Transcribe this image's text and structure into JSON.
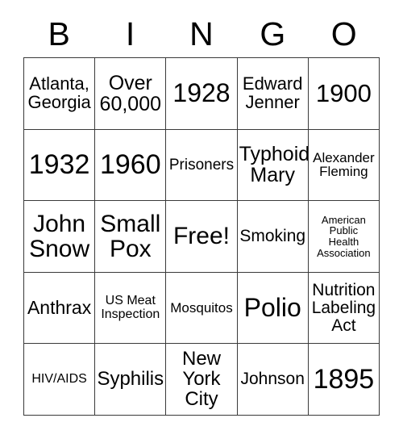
{
  "card": {
    "title": "BINGO",
    "free_space_label": "Free!",
    "text_color": "#000000",
    "border_color": "#3a3a3a",
    "background_color": "#ffffff"
  },
  "header": {
    "letters": [
      {
        "label": "B"
      },
      {
        "label": "I"
      },
      {
        "label": "N"
      },
      {
        "label": "G"
      },
      {
        "label": "O"
      }
    ]
  },
  "grid": {
    "columns": 5,
    "rows": 5,
    "cells": [
      {
        "text": "Atlanta,\nGeorgia",
        "size": "fs-22",
        "column": "B",
        "row": 1
      },
      {
        "text": "Over\n60,000",
        "size": "fs-25",
        "column": "I",
        "row": 1
      },
      {
        "text": "1928",
        "size": "fs-32",
        "column": "N",
        "row": 1
      },
      {
        "text": "Edward\nJenner",
        "size": "fs-22",
        "column": "G",
        "row": 1
      },
      {
        "text": "1900",
        "size": "fs-31",
        "column": "O",
        "row": 1
      },
      {
        "text": "1932",
        "size": "fs-34",
        "column": "B",
        "row": 2
      },
      {
        "text": "1960",
        "size": "fs-34",
        "column": "I",
        "row": 2
      },
      {
        "text": "Prisoners",
        "size": "fs-19",
        "column": "N",
        "row": 2
      },
      {
        "text": "Typhoid\nMary",
        "size": "fs-25",
        "column": "G",
        "row": 2
      },
      {
        "text": "Alexander\nFleming",
        "size": "fs-17",
        "column": "O",
        "row": 2
      },
      {
        "text": "John\nSnow",
        "size": "fs-30",
        "column": "B",
        "row": 3
      },
      {
        "text": "Small\nPox",
        "size": "fs-30",
        "column": "I",
        "row": 3
      },
      {
        "text": "Free!",
        "size": "fs-30",
        "column": "N",
        "row": 3
      },
      {
        "text": "Smoking",
        "size": "fs-21",
        "column": "G",
        "row": 3
      },
      {
        "text": "American\nPublic\nHealth\nAssociation",
        "size": "fs-13",
        "column": "O",
        "row": 3
      },
      {
        "text": "Anthrax",
        "size": "fs-23",
        "column": "B",
        "row": 4
      },
      {
        "text": "US Meat\nInspection",
        "size": "fs-16",
        "column": "I",
        "row": 4
      },
      {
        "text": "Mosquitos",
        "size": "fs-17",
        "column": "N",
        "row": 4
      },
      {
        "text": "Polio",
        "size": "fs-32",
        "column": "G",
        "row": 4
      },
      {
        "text": "Nutrition\nLabeling\nAct",
        "size": "fs-21",
        "column": "O",
        "row": 4
      },
      {
        "text": "HIV/AIDS",
        "size": "fs-16",
        "column": "B",
        "row": 5
      },
      {
        "text": "Syphilis",
        "size": "fs-24",
        "column": "I",
        "row": 5
      },
      {
        "text": "New\nYork\nCity",
        "size": "fs-24",
        "column": "N",
        "row": 5
      },
      {
        "text": "Johnson",
        "size": "fs-21",
        "column": "G",
        "row": 5
      },
      {
        "text": "1895",
        "size": "fs-34",
        "column": "O",
        "row": 5
      }
    ]
  }
}
